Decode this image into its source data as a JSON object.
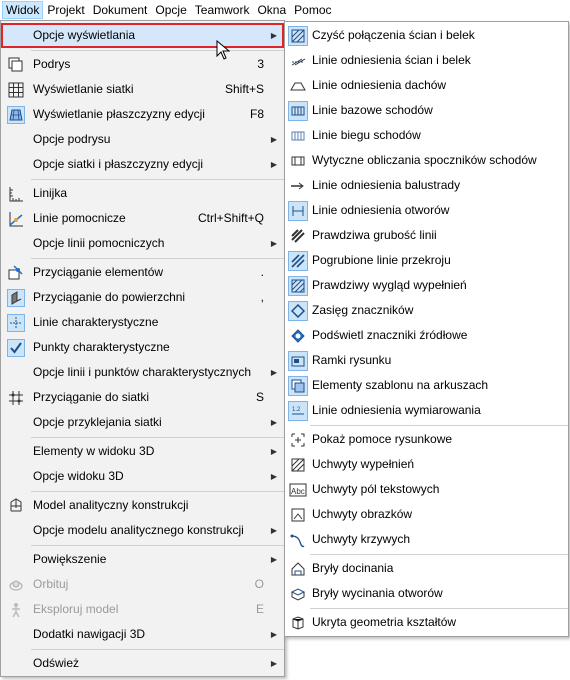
{
  "menubar": {
    "items": [
      "Widok",
      "Projekt",
      "Dokument",
      "Opcje",
      "Teamwork",
      "Okna",
      "Pomoc"
    ]
  },
  "main_menu": {
    "items": [
      {
        "label": "Opcje wyświetlania",
        "shortcut": "",
        "submenu": true,
        "icon": "none",
        "highlighted": true
      },
      {
        "label": "Podrys",
        "shortcut": "3",
        "icon": "layers-icon"
      },
      {
        "label": "Wyświetlanie siatki",
        "shortcut": "Shift+S",
        "icon": "grid-icon"
      },
      {
        "label": "Wyświetlanie płaszczyzny edycji",
        "shortcut": "F8",
        "icon": "plane-icon"
      },
      {
        "label": "Opcje podrysu",
        "submenu": true
      },
      {
        "label": "Opcje siatki i płaszczyzny edycji",
        "submenu": true
      },
      {
        "label": "Linijka",
        "icon": "ruler-icon"
      },
      {
        "label": "Linie pomocnicze",
        "shortcut": "Ctrl+Shift+Q",
        "icon": "guide-line-icon"
      },
      {
        "label": "Opcje linii pomocniczych",
        "submenu": true
      },
      {
        "label": "Przyciąganie elementów",
        "shortcut": ".",
        "icon": "snap-elements-icon"
      },
      {
        "label": "Przyciąganie do powierzchni",
        "shortcut": ",",
        "icon": "snap-surface-icon"
      },
      {
        "label": "Linie charakterystyczne",
        "icon": "special-lines-icon"
      },
      {
        "label": "Punkty charakterystyczne",
        "icon": "check-icon"
      },
      {
        "label": "Opcje linii i punktów charakterystycznych",
        "submenu": true
      },
      {
        "label": "Przyciąganie do siatki",
        "shortcut": "S",
        "icon": "grid-snap-icon"
      },
      {
        "label": "Opcje przyklejania siatki",
        "submenu": true
      },
      {
        "label": "Elementy w widoku 3D",
        "submenu": true
      },
      {
        "label": "Opcje widoku 3D",
        "submenu": true
      },
      {
        "label": "Model analityczny konstrukcji",
        "icon": "structural-model-icon"
      },
      {
        "label": "Opcje modelu analitycznego konstrukcji",
        "submenu": true
      },
      {
        "label": "Powiększenie",
        "submenu": true
      },
      {
        "label": "Orbituj",
        "shortcut": "O",
        "icon": "orbit-icon",
        "disabled": true
      },
      {
        "label": "Eksploruj model",
        "shortcut": "E",
        "icon": "walk-icon",
        "disabled": true
      },
      {
        "label": "Dodatki nawigacji 3D",
        "submenu": true
      },
      {
        "label": "Odśwież",
        "submenu": true
      }
    ]
  },
  "sub_menu": {
    "items": [
      "Czyść połączenia ścian i belek",
      "Linie odniesienia ścian i belek",
      "Linie odniesienia dachów",
      "Linie bazowe schodów",
      "Linie biegu schodów",
      "Wytyczne obliczania spoczników schodów",
      "Linie odniesienia balustrady",
      "Linie odniesienia otworów",
      "Prawdziwa grubość linii",
      "Pogrubione linie przekroju",
      "Prawdziwy wygląd wypełnień",
      "Zasięg znaczników",
      "Podświetl znaczniki źródłowe",
      "Ramki rysunku",
      "Elementy szablonu na arkuszach",
      "Linie odniesienia wymiarowania",
      "Pokaż pomoce rysunkowe",
      "Uchwyty wypełnień",
      "Uchwyty pól tekstowych",
      "Uchwyty obrazków",
      "Uchwyty krzywych",
      "Bryły docinania",
      "Bryły wycinania otworów",
      "Ukryta geometria kształtów"
    ]
  },
  "colors": {
    "accent": "#0b5fb3",
    "highlight_border": "#e0242b",
    "highlight_bg": "#d5e8fb"
  }
}
